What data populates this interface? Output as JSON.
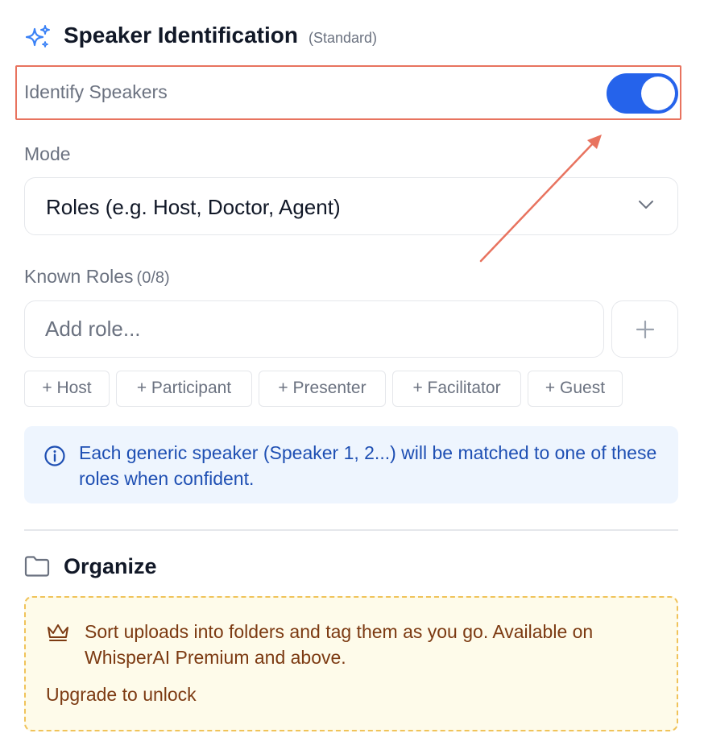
{
  "header": {
    "icon": "sparkles-icon",
    "title": "Speaker Identification",
    "tag": "(Standard)"
  },
  "identify": {
    "label": "Identify Speakers",
    "enabled": true,
    "toggle_color": "#2563eb"
  },
  "mode": {
    "label": "Mode",
    "selected": "Roles (e.g. Host, Doctor, Agent)"
  },
  "known_roles": {
    "label": "Known Roles",
    "count": "(0/8)",
    "input_placeholder": "Add role...",
    "add_icon": "plus-icon",
    "suggestions": [
      "+ Host",
      "+ Participant",
      "+ Presenter",
      "+ Facilitator",
      "+ Guest"
    ]
  },
  "info": {
    "icon": "info-icon",
    "text": "Each generic speaker (Speaker 1, 2...) will be matched to one of these roles when confident."
  },
  "organize": {
    "icon": "folder-icon",
    "title": "Organize",
    "promo_icon": "crown-icon",
    "promo_text": "Sort uploads into folders and tag them as you go. Available on WhisperAI Premium and above.",
    "upgrade_link": "Upgrade to unlock"
  },
  "annotation": {
    "color": "#e8735f"
  }
}
